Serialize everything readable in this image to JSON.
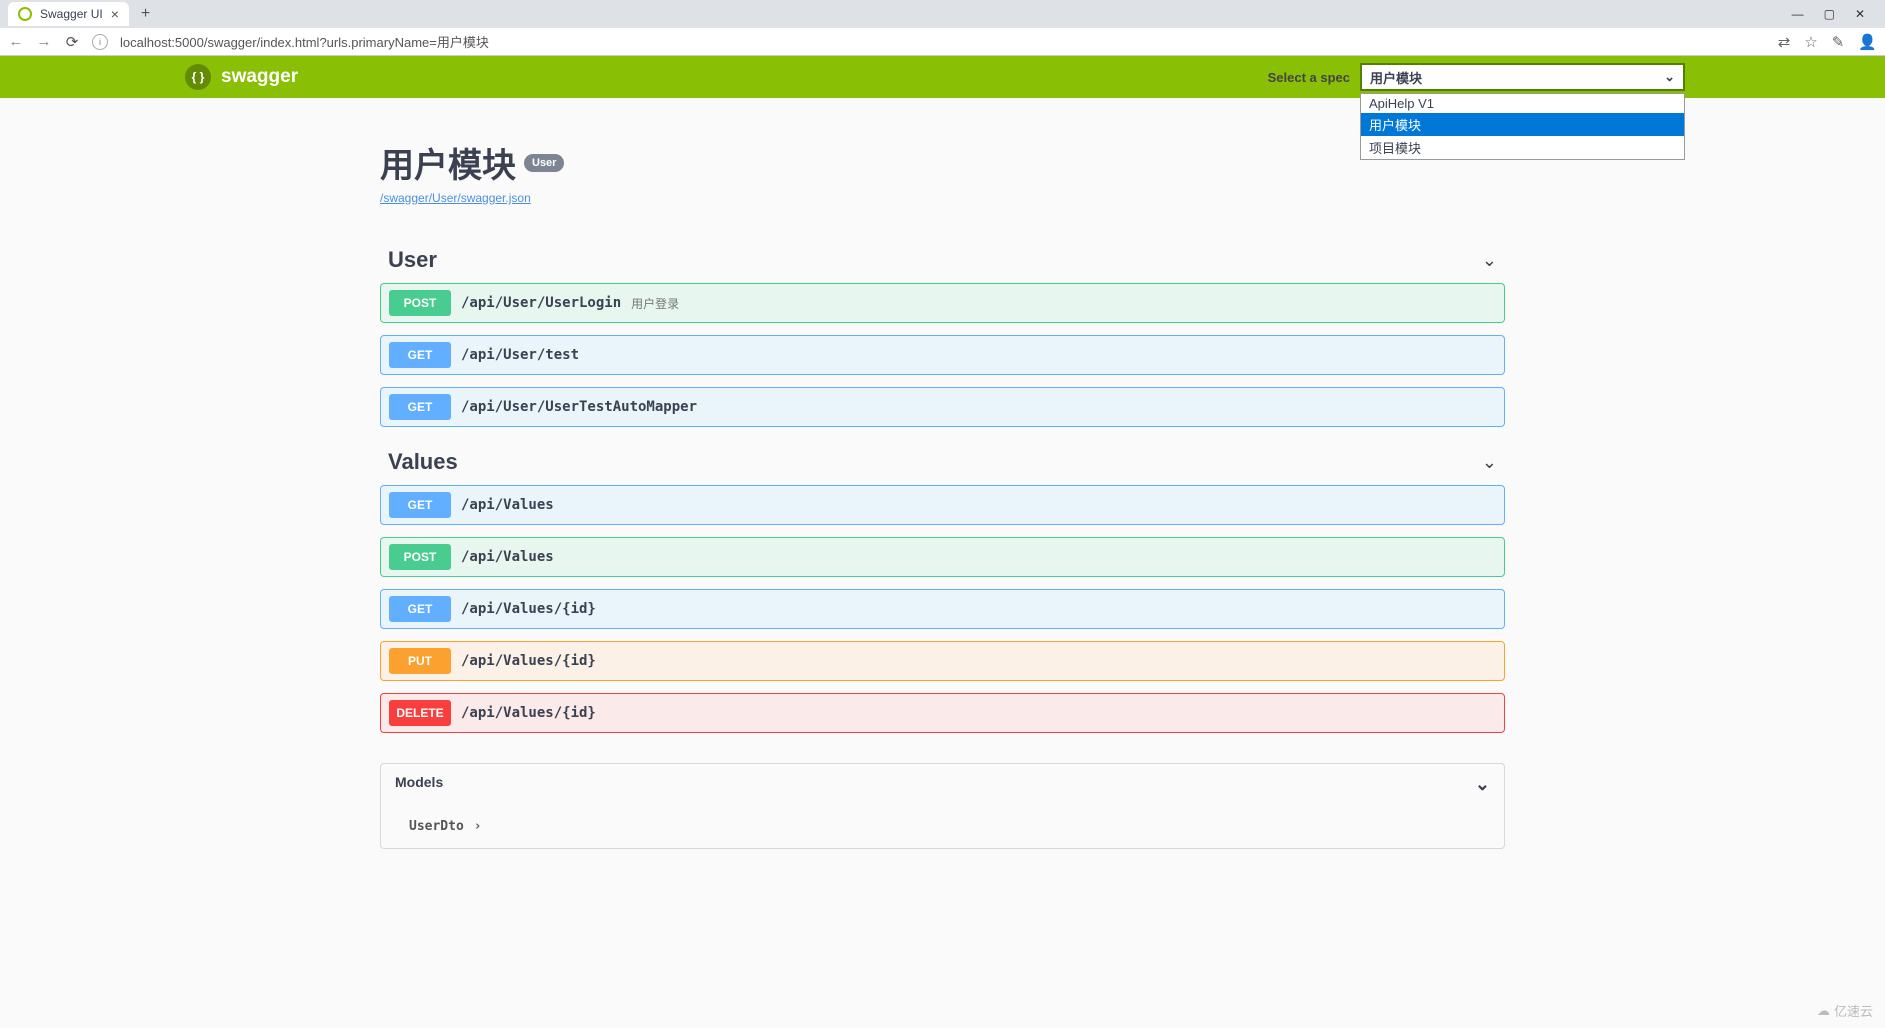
{
  "browser": {
    "tab_title": "Swagger UI",
    "url": "localhost:5000/swagger/index.html?urls.primaryName=用户模块",
    "window_controls": {
      "min": "—",
      "max": "▢",
      "close": "✕"
    }
  },
  "topbar": {
    "logo_text": "swagger",
    "select_label": "Select a spec",
    "selected_spec": "用户模块",
    "options": [
      "ApiHelp V1",
      "用户模块",
      "项目模块"
    ]
  },
  "info": {
    "title": "用户模块",
    "badge": "User",
    "spec_url": "/swagger/User/swagger.json"
  },
  "sections": [
    {
      "name": "User",
      "ops": [
        {
          "method": "POST",
          "path": "/api/User/UserLogin",
          "summary": "用户登录"
        },
        {
          "method": "GET",
          "path": "/api/User/test",
          "summary": ""
        },
        {
          "method": "GET",
          "path": "/api/User/UserTestAutoMapper",
          "summary": ""
        }
      ]
    },
    {
      "name": "Values",
      "ops": [
        {
          "method": "GET",
          "path": "/api/Values",
          "summary": ""
        },
        {
          "method": "POST",
          "path": "/api/Values",
          "summary": ""
        },
        {
          "method": "GET",
          "path": "/api/Values/{id}",
          "summary": ""
        },
        {
          "method": "PUT",
          "path": "/api/Values/{id}",
          "summary": ""
        },
        {
          "method": "DELETE",
          "path": "/api/Values/{id}",
          "summary": ""
        }
      ]
    }
  ],
  "models": {
    "header": "Models",
    "items": [
      "UserDto"
    ]
  },
  "watermark": "亿速云"
}
